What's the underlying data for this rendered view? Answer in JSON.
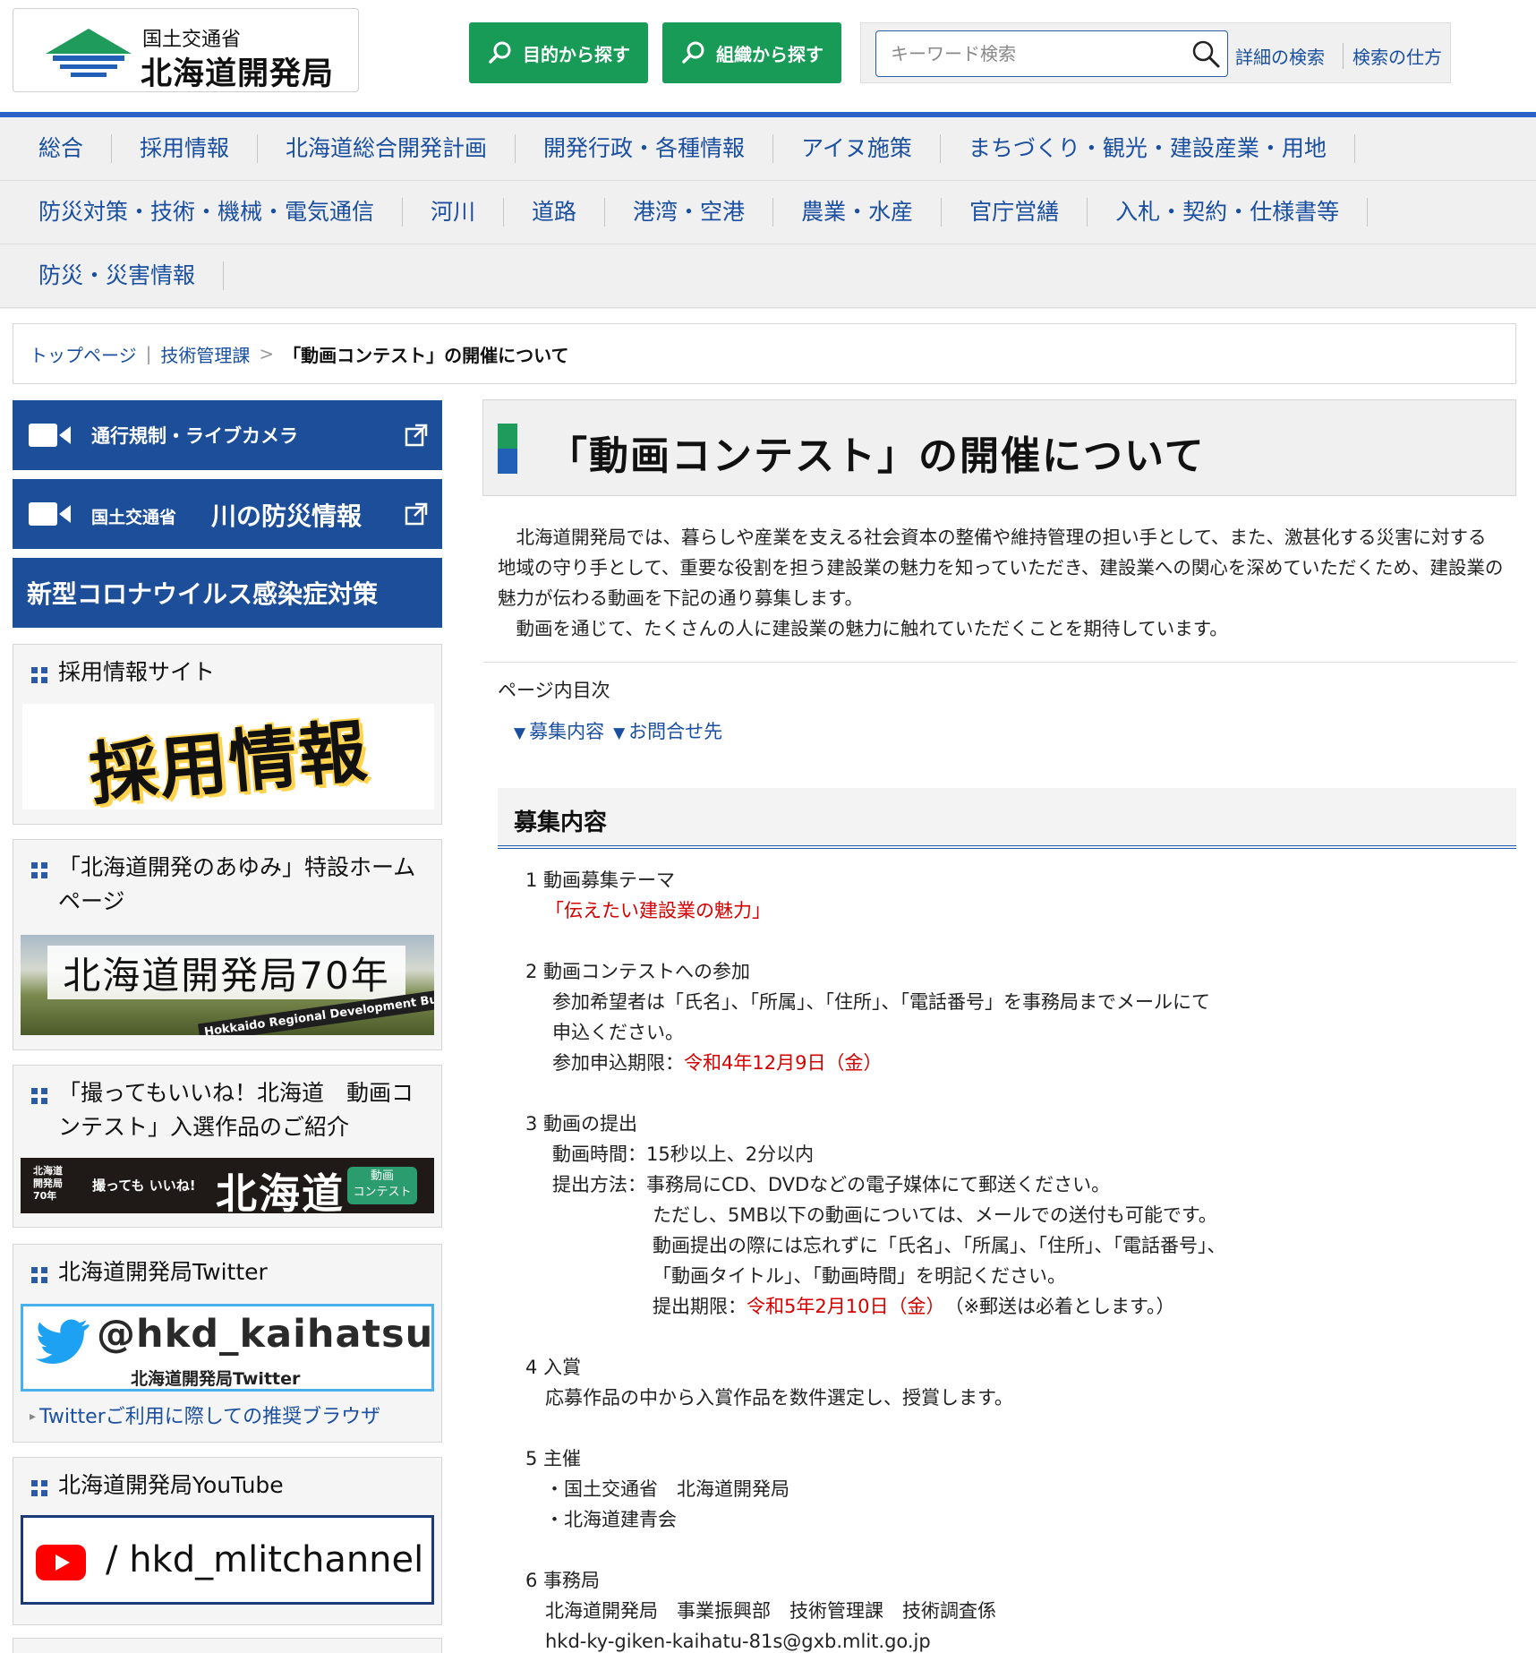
{
  "header": {
    "logo_sub": "国土交通省",
    "logo_main": "北海道開発局",
    "btn_purpose": "目的から探す",
    "btn_org": "組織から探す",
    "search_placeholder": "キーワード検索",
    "advanced_search": "詳細の検索",
    "search_howto": "検索の仕方"
  },
  "gnav": {
    "row1": [
      "総合",
      "採用情報",
      "北海道総合開発計画",
      "開発行政・各種情報",
      "アイヌ施策",
      "まちづくり・観光・建設産業・用地"
    ],
    "row2": [
      "防災対策・技術・機械・電気通信",
      "河川",
      "道路",
      "港湾・空港",
      "農業・水産",
      "官庁営繕",
      "入札・契約・仕様書等"
    ],
    "row3": [
      "防災・災害情報"
    ]
  },
  "breadcrumb": {
    "top": "トップページ",
    "section": "技術管理課",
    "current": "「動画コンテスト」の開催について"
  },
  "sidebar": {
    "traffic": "通行規制・ライブカメラ",
    "river_small": "国土交通省",
    "river_big": "川の防災情報",
    "corona": "新型コロナウイルス感染症対策",
    "recruit_title": "採用情報サイト",
    "recruit_banner": "採用情報",
    "ayumi_title": "「北海道開発のあゆみ」特設ホームページ",
    "ayumi_banner": "北海道開発局70年",
    "ayumi_banner_sub": "Hokkaido Regional Development Bureau",
    "contest_title": "「撮ってもいいね！北海道　動画コンテスト」入選作品のご紹介",
    "contest_banner_left": "北海道\n開発局\n70年",
    "contest_banner_mid": "撮っても いいね!",
    "contest_banner_big": "北海道",
    "contest_banner_badge": "動画\nコンテスト",
    "twitter_title": "北海道開発局Twitter",
    "twitter_handle": "@hkd_kaihatsu",
    "twitter_name": "北海道開発局Twitter",
    "twitter_link": "Twitterご利用に際しての推奨ブラウザ",
    "youtube_title": "北海道開発局YouTube",
    "youtube_handle": "/  hkd_mlitchannel"
  },
  "main": {
    "title": "「動画コンテスト」の開催について",
    "intro_p1": "北海道開発局では、暮らしや産業を支える社会資本の整備や維持管理の担い手として、また、激甚化する災害に対する地域の守り手として、重要な役割を担う建設業の魅力を知っていただき、建設業への関心を深めていただくため、建設業の魅力が伝わる動画を下記の通り募集します。",
    "intro_p2": "動画を通じて、たくさんの人に建設業の魅力に触れていただくことを期待しています。",
    "toc_label": "ページ内目次",
    "toc_links": [
      "募集内容",
      "お問合せ先"
    ],
    "section_heading": "募集内容",
    "s1_head": "1 動画募集テーマ",
    "s1_theme": "「伝えたい建設業の魅力」",
    "s2_head": "2 動画コンテストへの参加",
    "s2_line1": "参加希望者は「氏名」、「所属」、「住所」、「電話番号」を事務局までメールにて",
    "s2_line2": "申込ください。",
    "s2_deadline_label": "参加申込期限：",
    "s2_deadline": "令和4年12月9日（金）",
    "s3_head": "3 動画の提出",
    "s3_time": "動画時間：15秒以上、2分以内",
    "s3_method": "提出方法：事務局にCD、DVDなどの電子媒体にて郵送ください。",
    "s3_line2": "ただし、5MB以下の動画については、メールでの送付も可能です。",
    "s3_line3": "動画提出の際には忘れずに「氏名」、「所属」、「住所」、「電話番号」、",
    "s3_line4": "「動画タイトル」、「動画時間」を明記ください。",
    "s3_deadline_label": "提出期限：",
    "s3_deadline": "令和5年2月10日（金）",
    "s3_note": "　（※郵送は必着とします。）",
    "s4_head": "4 入賞",
    "s4_text": "応募作品の中から入賞作品を数件選定し、授賞します。",
    "s5_head": "5 主催",
    "s5_org1": "・国土交通省　北海道開発局",
    "s5_org2": "・北海道建青会",
    "s6_head": "6 事務局",
    "s6_office": "北海道開発局　事業振興部　技術管理課　技術調査係",
    "s6_email": "hkd-ky-giken-kaihatu-81s@gxb.mlit.go.jp"
  }
}
